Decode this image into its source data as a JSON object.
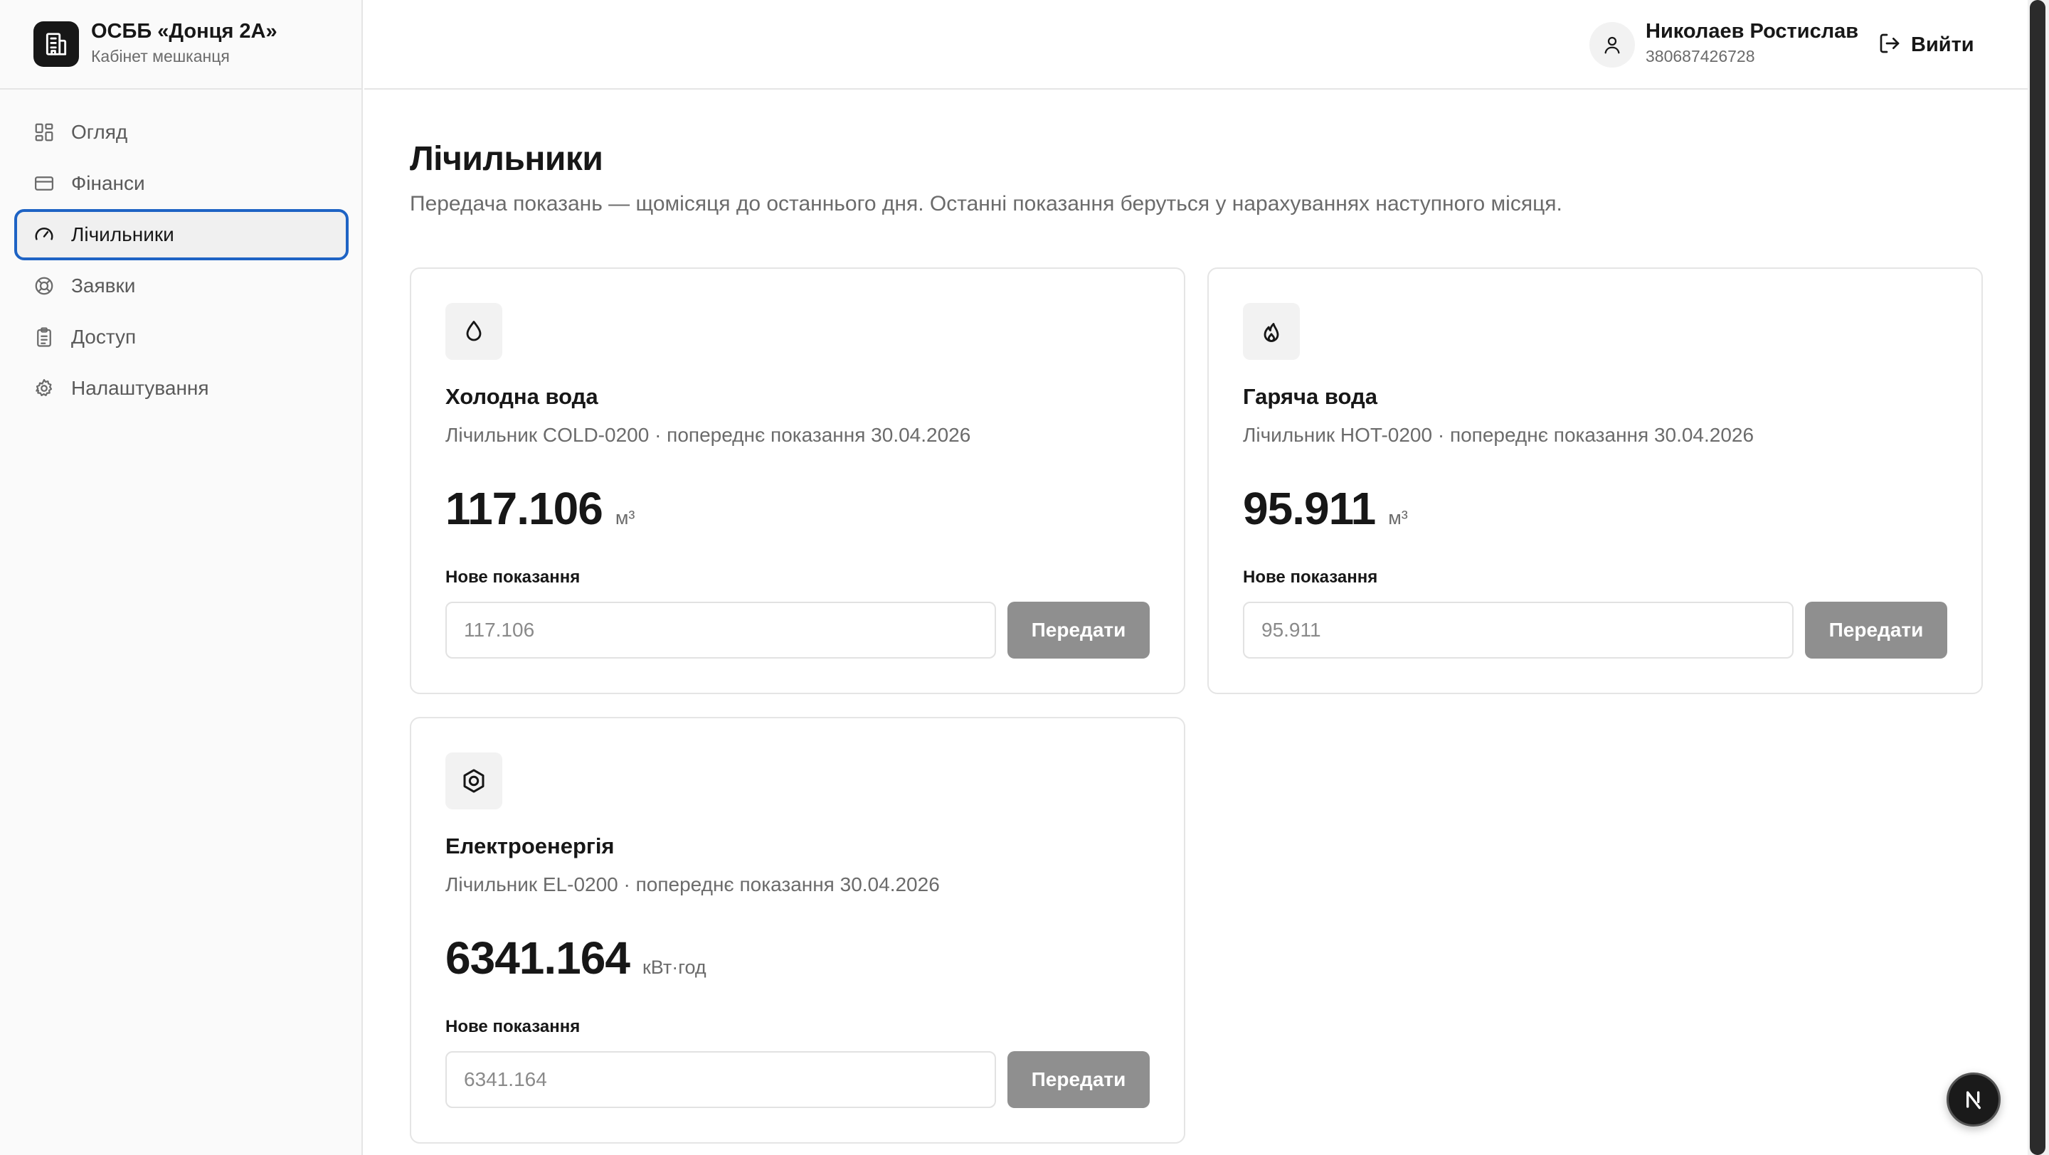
{
  "brand": {
    "title": "ОСББ «Донця 2А»",
    "subtitle": "Кабінет мешканця",
    "icon": "building-icon"
  },
  "sidebar": {
    "items": [
      {
        "label": "Огляд",
        "icon": "dashboard-icon",
        "active": false
      },
      {
        "label": "Фінанси",
        "icon": "credit-card-icon",
        "active": false
      },
      {
        "label": "Лічильники",
        "icon": "gauge-icon",
        "active": true
      },
      {
        "label": "Заявки",
        "icon": "lifebuoy-icon",
        "active": false
      },
      {
        "label": "Доступ",
        "icon": "clipboard-icon",
        "active": false
      },
      {
        "label": "Налаштування",
        "icon": "gear-icon",
        "active": false
      }
    ]
  },
  "header": {
    "user_name": "Николаев Ростислав",
    "user_phone": "380687426728",
    "logout_label": "Вийти"
  },
  "main": {
    "title": "Лічильники",
    "subtitle": "Передача показань — щомісяця до останнього дня. Останні показання беруться у нарахуваннях наступного місяця.",
    "meters": [
      {
        "title": "Холодна вода",
        "description": "Лічильник COLD-0200 · попереднє показання 30.04.2026",
        "value": "117.106",
        "unit": "м³",
        "new_label": "Нове показання",
        "input_placeholder": "117.106",
        "submit_label": "Передати",
        "icon": "droplet-icon"
      },
      {
        "title": "Гаряча вода",
        "description": "Лічильник HOT-0200 · попереднє показання 30.04.2026",
        "value": "95.911",
        "unit": "м³",
        "new_label": "Нове показання",
        "input_placeholder": "95.911",
        "submit_label": "Передати",
        "icon": "flame-icon"
      },
      {
        "title": "Електроенергія",
        "description": "Лічильник EL-0200 · попереднє показання 30.04.2026",
        "value": "6341.164",
        "unit": "кВт·год",
        "new_label": "Нове показання",
        "input_placeholder": "6341.164",
        "submit_label": "Передати",
        "icon": "hexagon-nut-icon"
      }
    ]
  },
  "colors": {
    "accent": "#1e63c4",
    "button_disabled": "#8f8f8f",
    "text_primary": "#171717",
    "text_muted": "#6b6b6b"
  }
}
